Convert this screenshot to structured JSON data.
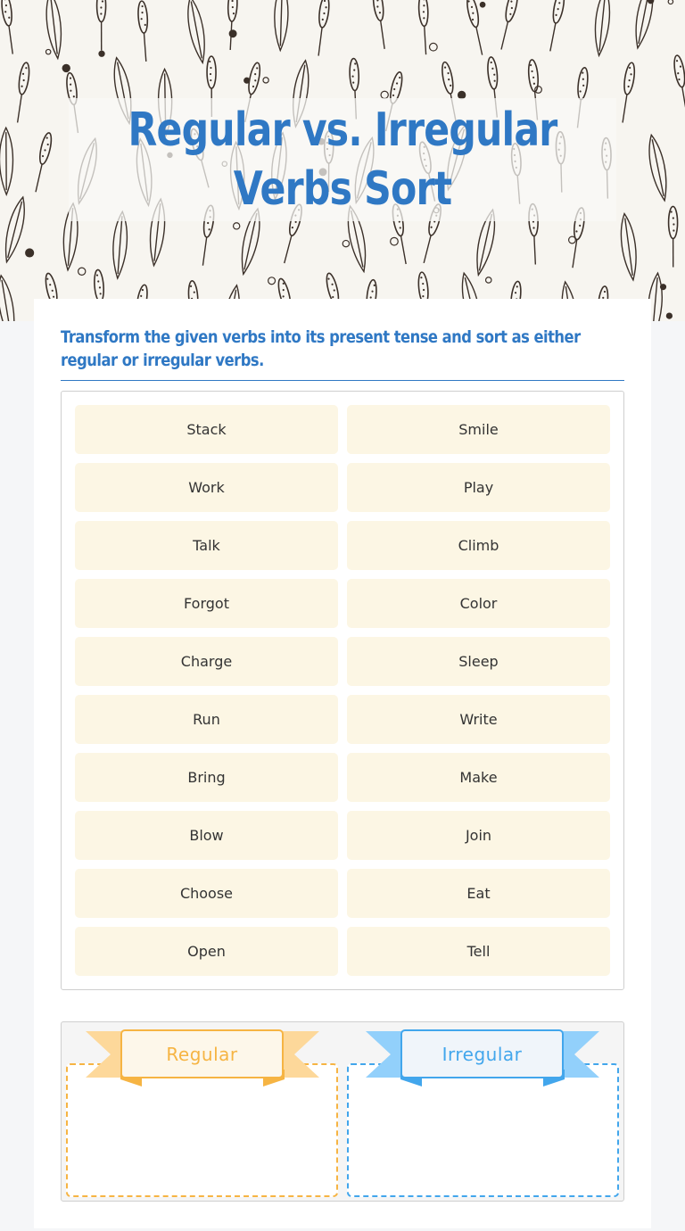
{
  "header": {
    "title": "Regular vs. Irregular Verbs Sort",
    "colors": {
      "title": "#2f78c4",
      "pattern_ink": "#3b3029",
      "pattern_bg": "#f7f5f0"
    }
  },
  "instructions": {
    "text": "Transform the given verbs into its present tense and sort as either regular or irregular verbs."
  },
  "verbs": [
    {
      "label": "Stack"
    },
    {
      "label": "Smile"
    },
    {
      "label": "Work"
    },
    {
      "label": "Play"
    },
    {
      "label": "Talk"
    },
    {
      "label": "Climb"
    },
    {
      "label": "Forgot"
    },
    {
      "label": "Color"
    },
    {
      "label": "Charge"
    },
    {
      "label": "Sleep"
    },
    {
      "label": "Run"
    },
    {
      "label": "Write"
    },
    {
      "label": "Bring"
    },
    {
      "label": "Make"
    },
    {
      "label": "Blow"
    },
    {
      "label": "Join"
    },
    {
      "label": "Choose"
    },
    {
      "label": "Eat"
    },
    {
      "label": "Open"
    },
    {
      "label": "Tell"
    }
  ],
  "bins": [
    {
      "label": "Regular",
      "color": "#f6b443",
      "ribbon_color": "#fdd89a"
    },
    {
      "label": "Irregular",
      "color": "#42a6ec",
      "ribbon_color": "#92d0fb"
    }
  ]
}
